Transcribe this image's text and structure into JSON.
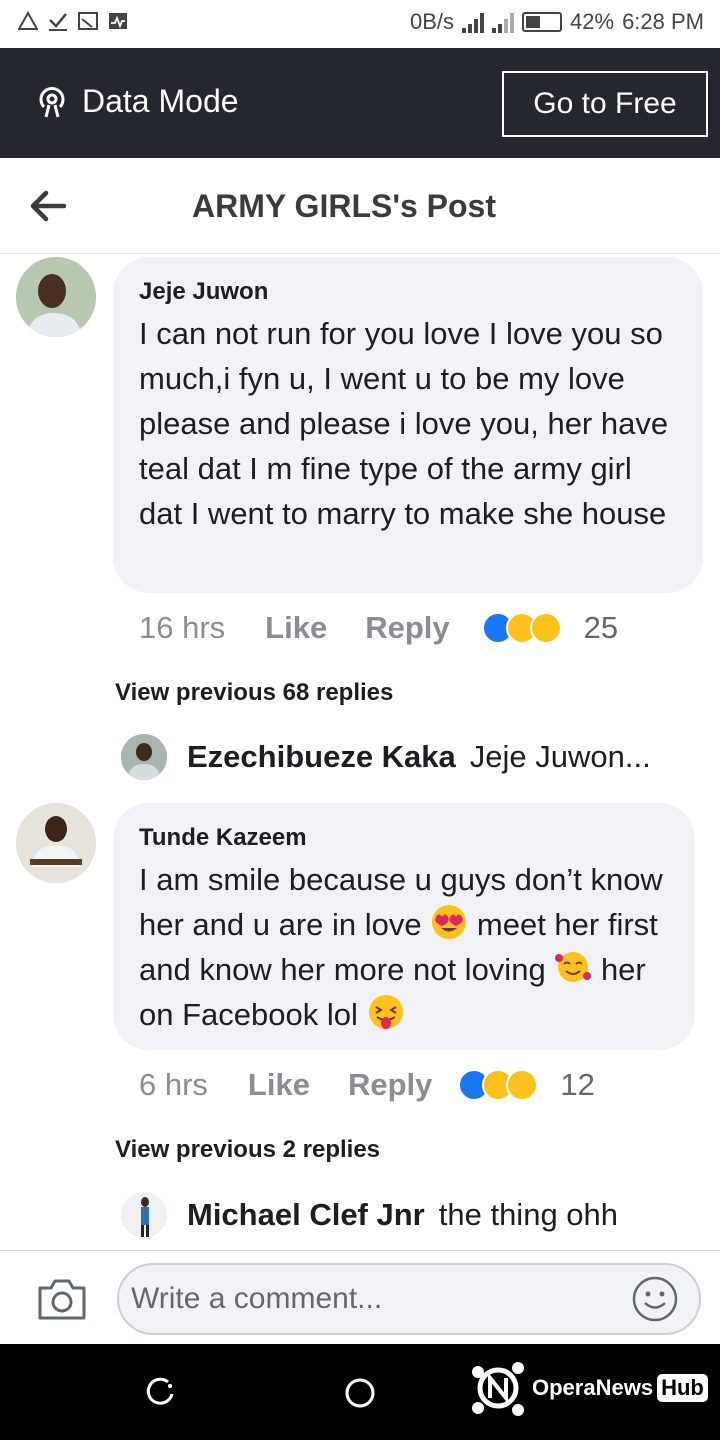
{
  "status_bar": {
    "net_speed": "0B/s",
    "battery": "42%",
    "time": "6:28 PM"
  },
  "data_mode": {
    "label": "Data Mode",
    "button": "Go to Free"
  },
  "header": {
    "title": "ARMY GIRLS's Post"
  },
  "comments": [
    {
      "author": "Jeje Juwon",
      "text": "I can not run for you love I love you so much,i fyn u, I went u to be my love please and please i love you, her have teal dat I m fine type of the army girl dat I went to marry to make she house",
      "time": "16 hrs",
      "like": "Like",
      "reply": "Reply",
      "reaction_count": "25",
      "view_previous": "View previous 68 replies",
      "latest_reply": {
        "author": "Ezechibueze Kaka",
        "text": "Jeje Juwon..."
      }
    },
    {
      "author": "Tunde Kazeem",
      "text_parts": [
        "I am smile because u guys don’t know her and u are in love",
        "meet her first and know her more not loving",
        "her on Facebook lol"
      ],
      "time": "6 hrs",
      "like": "Like",
      "reply": "Reply",
      "reaction_count": "12",
      "view_previous": "View previous 2 replies",
      "latest_reply": {
        "author": "Michael Clef Jnr",
        "text": "the thing ohh"
      }
    }
  ],
  "composer": {
    "placeholder": "Write a comment..."
  },
  "watermark": {
    "brand": "OperaNews",
    "hub": "Hub"
  },
  "colors": {
    "data_bar": "#24272d",
    "bubble": "#f0f2f5",
    "meta_text": "#8a8d91",
    "like_blue": "#1877f2",
    "emoji_yellow": "#fcc21b"
  }
}
